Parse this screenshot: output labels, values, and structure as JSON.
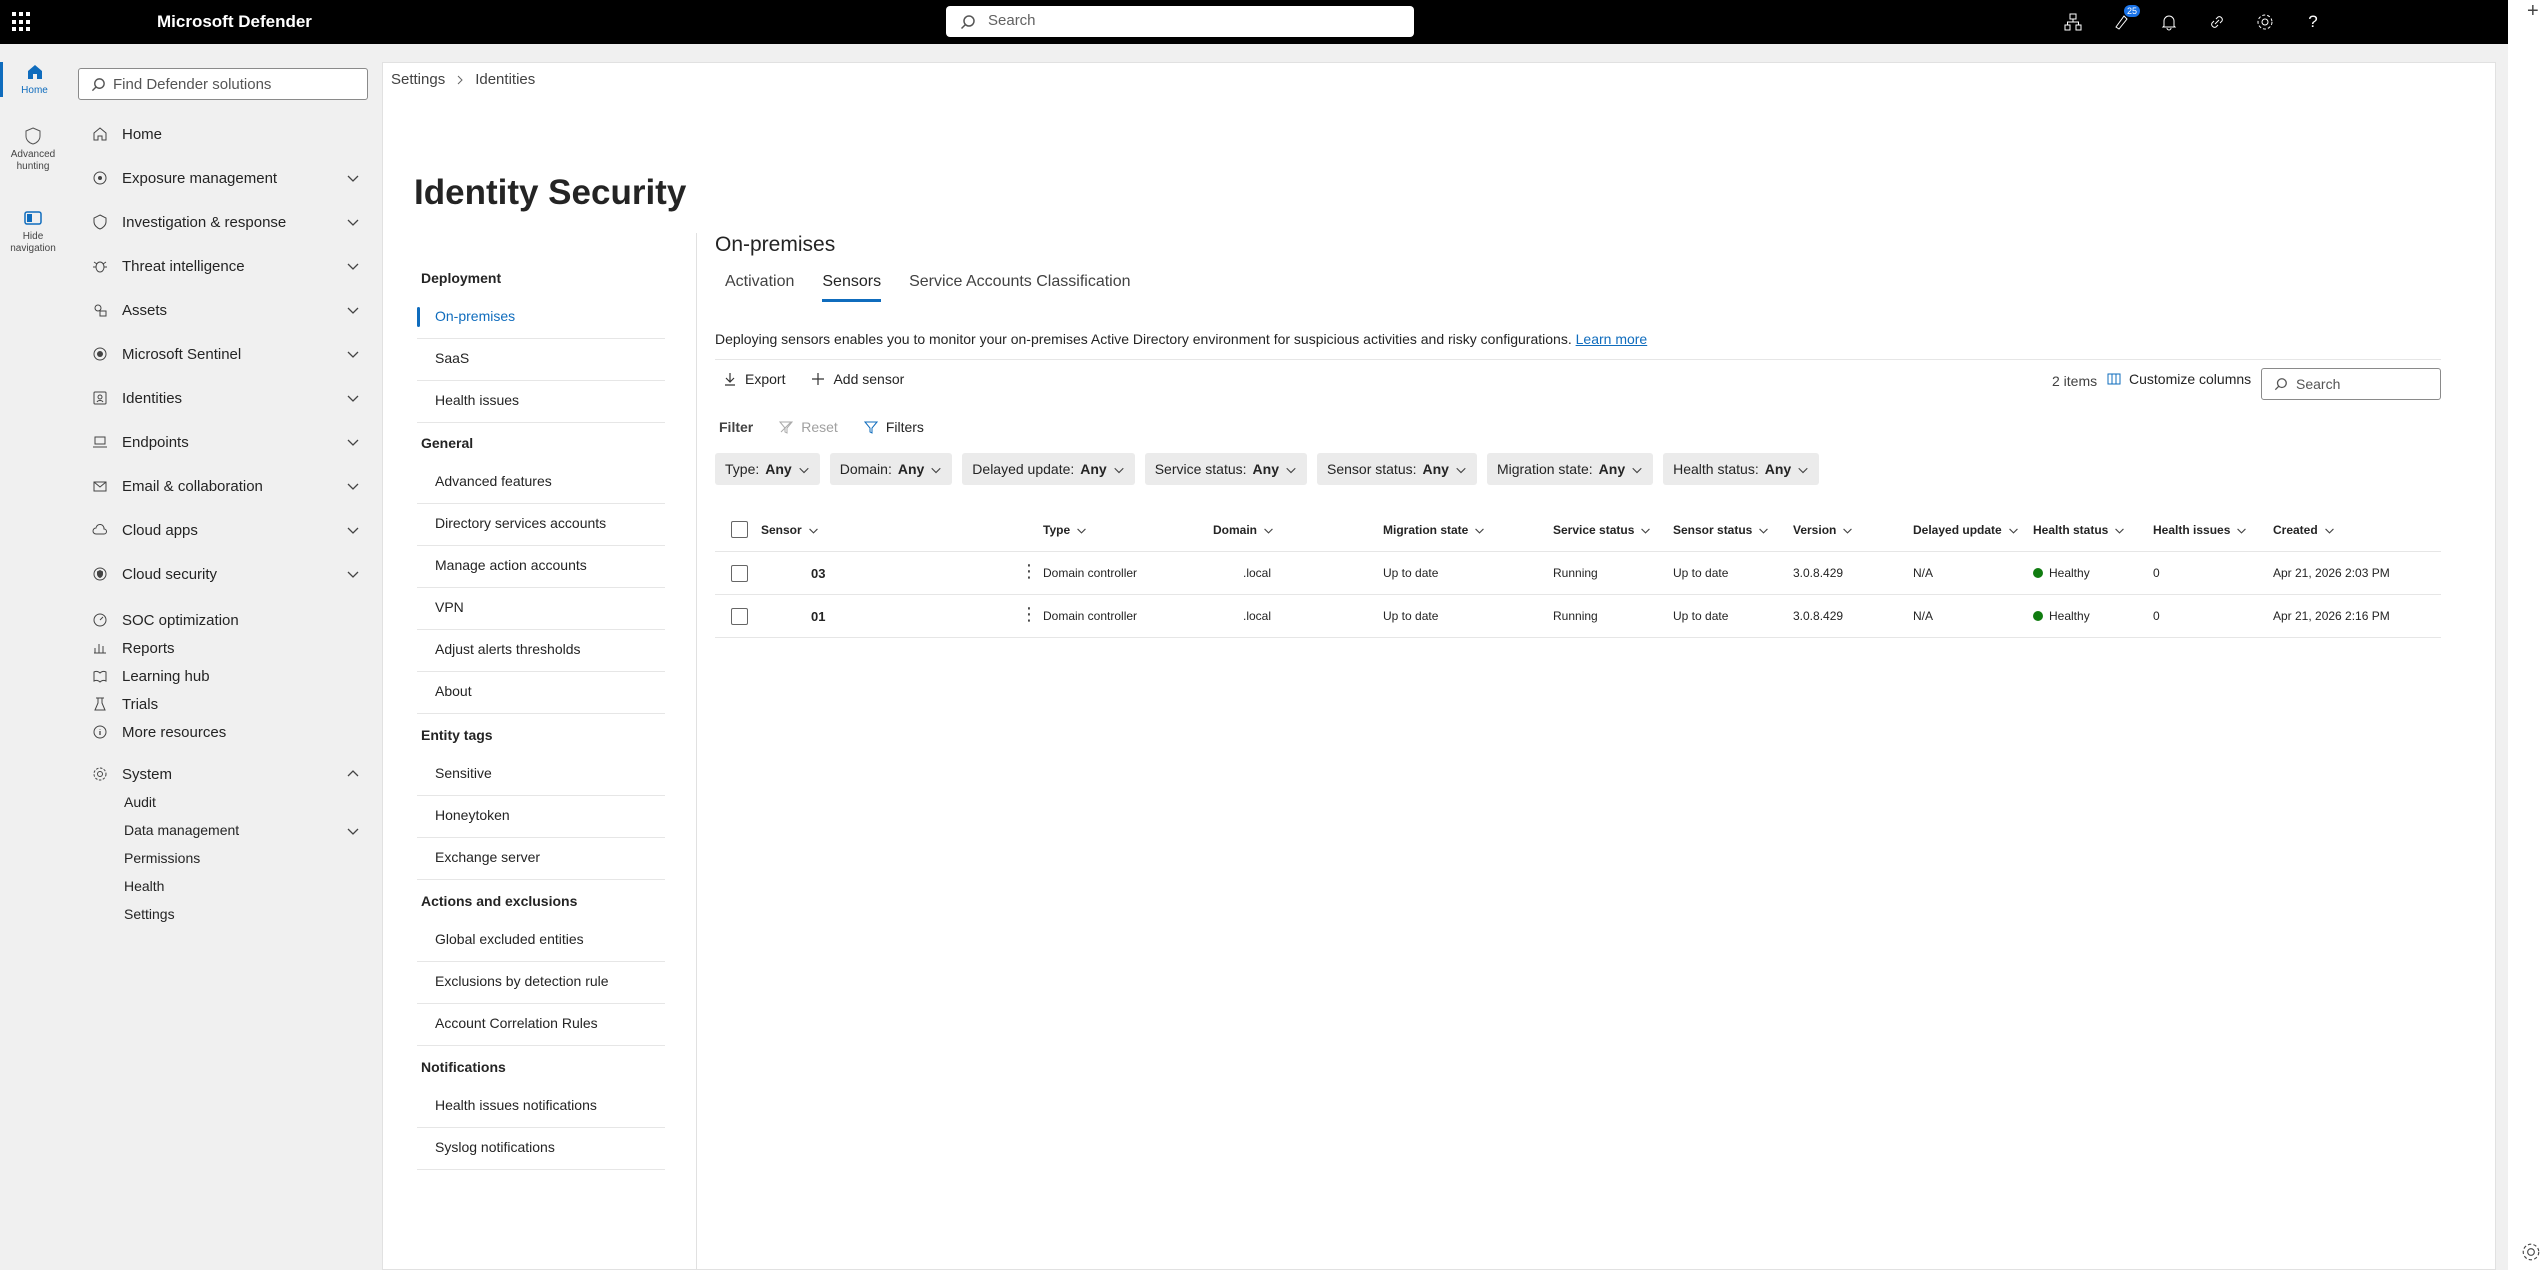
{
  "app": {
    "title": "Microsoft Defender",
    "search_placeholder": "Search",
    "notification_count": "25"
  },
  "rail": [
    {
      "label": "Home"
    },
    {
      "label": "Advanced hunting"
    },
    {
      "label": "Hide navigation"
    }
  ],
  "nav": {
    "find_placeholder": "Find Defender solutions",
    "items": [
      {
        "label": "Home"
      },
      {
        "label": "Exposure management"
      },
      {
        "label": "Investigation & response"
      },
      {
        "label": "Threat intelligence"
      },
      {
        "label": "Assets"
      },
      {
        "label": "Microsoft Sentinel"
      },
      {
        "label": "Identities"
      },
      {
        "label": "Endpoints"
      },
      {
        "label": "Email & collaboration"
      },
      {
        "label": "Cloud apps"
      },
      {
        "label": "Cloud security"
      },
      {
        "label": "SOC optimization"
      },
      {
        "label": "Reports"
      },
      {
        "label": "Learning hub"
      },
      {
        "label": "Trials"
      },
      {
        "label": "More resources"
      },
      {
        "label": "System"
      }
    ],
    "system_sub": [
      {
        "label": "Audit"
      },
      {
        "label": "Data management"
      },
      {
        "label": "Permissions"
      },
      {
        "label": "Health"
      },
      {
        "label": "Settings"
      }
    ]
  },
  "breadcrumb": {
    "first": "Settings",
    "second": "Identities"
  },
  "page": {
    "title": "Identity Security"
  },
  "subnav": {
    "deployment": {
      "head": "Deployment",
      "items": [
        "On-premises",
        "SaaS",
        "Health issues"
      ]
    },
    "general": {
      "head": "General",
      "items": [
        "Advanced features",
        "Directory services accounts",
        "Manage action accounts",
        "VPN",
        "Adjust alerts thresholds",
        "About"
      ]
    },
    "entity_tags": {
      "head": "Entity tags",
      "items": [
        "Sensitive",
        "Honeytoken",
        "Exchange server"
      ]
    },
    "actions": {
      "head": "Actions and exclusions",
      "items": [
        "Global excluded entities",
        "Exclusions by detection rule",
        "Account Correlation Rules"
      ]
    },
    "notifications": {
      "head": "Notifications",
      "items": [
        "Health issues notifications",
        "Syslog notifications"
      ]
    }
  },
  "content": {
    "section_title": "On-premises",
    "tabs": [
      "Activation",
      "Sensors",
      "Service Accounts Classification"
    ],
    "description": "Deploying sensors enables you to monitor your on-premises Active Directory environment for suspicious activities and risky configurations.",
    "learn_more": "Learn more",
    "export": "Export",
    "add_sensor": "Add sensor",
    "items_count": "2 items",
    "customize_columns": "Customize columns",
    "search_placeholder": "Search",
    "filter_label": "Filter",
    "reset": "Reset",
    "filters": "Filters",
    "pills": [
      {
        "label": "Type:",
        "value": "Any"
      },
      {
        "label": "Domain:",
        "value": "Any"
      },
      {
        "label": "Delayed update:",
        "value": "Any"
      },
      {
        "label": "Service status:",
        "value": "Any"
      },
      {
        "label": "Sensor status:",
        "value": "Any"
      },
      {
        "label": "Migration state:",
        "value": "Any"
      },
      {
        "label": "Health status:",
        "value": "Any"
      }
    ],
    "columns": [
      "Sensor",
      "Type",
      "Domain",
      "Migration state",
      "Service status",
      "Sensor status",
      "Version",
      "Delayed update",
      "Health status",
      "Health issues",
      "Created"
    ],
    "rows": [
      {
        "sensor": "03",
        "type": "Domain controller",
        "domain": ".local",
        "migration": "Up to date",
        "service": "Running",
        "sensor_status": "Up to date",
        "version": "3.0.8.429",
        "delayed": "N/A",
        "health": "Healthy",
        "issues": "0",
        "created": "Apr 21, 2026 2:03 PM"
      },
      {
        "sensor": "01",
        "type": "Domain controller",
        "domain": ".local",
        "migration": "Up to date",
        "service": "Running",
        "sensor_status": "Up to date",
        "version": "3.0.8.429",
        "delayed": "N/A",
        "health": "Healthy",
        "issues": "0",
        "created": "Apr 21, 2026 2:16 PM"
      }
    ]
  }
}
